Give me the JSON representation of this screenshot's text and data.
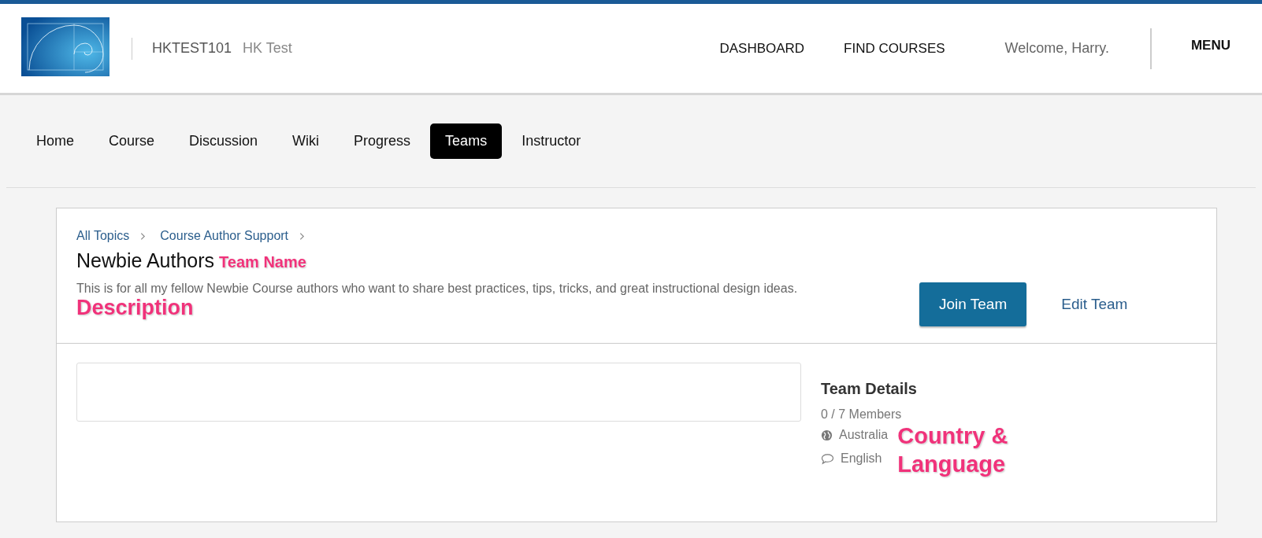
{
  "header": {
    "course_code": "HKTEST101",
    "course_name": "HK Test",
    "nav_links": [
      "DASHBOARD",
      "FIND COURSES"
    ],
    "welcome": "Welcome, Harry.",
    "menu": "MENU"
  },
  "tabs": [
    {
      "label": "Home",
      "selected": false
    },
    {
      "label": "Course",
      "selected": false
    },
    {
      "label": "Discussion",
      "selected": false
    },
    {
      "label": "Wiki",
      "selected": false
    },
    {
      "label": "Progress",
      "selected": false
    },
    {
      "label": "Teams",
      "selected": true
    },
    {
      "label": "Instructor",
      "selected": false
    }
  ],
  "breadcrumbs": [
    "All Topics",
    "Course Author Support"
  ],
  "team": {
    "name": "Newbie Authors",
    "name_annotation": "Team Name",
    "description": "This is for all my fellow Newbie Course authors who want to share best practices, tips, tricks, and great instructional design ideas.",
    "description_annotation": "Description",
    "buttons": [
      "Join Team",
      "Edit Team"
    ]
  },
  "details": {
    "title": "Team Details",
    "members": "0 / 7 Members",
    "country": "Australia",
    "language": "English",
    "annotation_line_1": "Country &",
    "annotation_line_2": "Language"
  }
}
